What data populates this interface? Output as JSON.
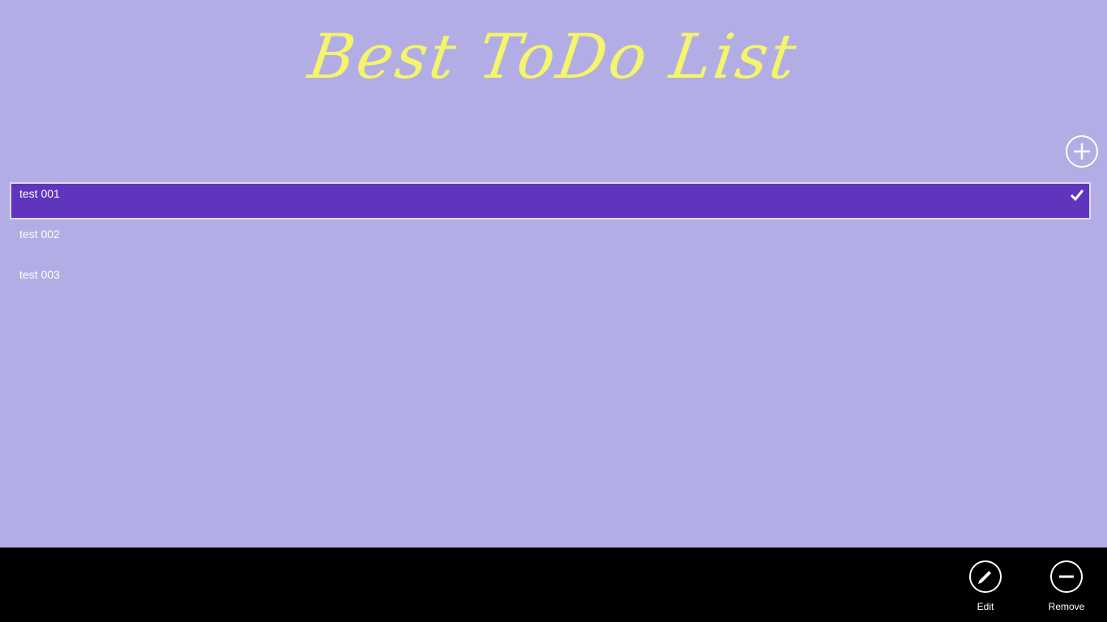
{
  "app": {
    "title": "Best ToDo List"
  },
  "colors": {
    "background": "#b3ade6",
    "title": "#f4f56a",
    "selected_item": "#5f35bd",
    "app_bar": "#000000"
  },
  "toolbar": {
    "add_icon": "plus-circle-icon"
  },
  "todos": [
    {
      "label": "test 001",
      "selected": true,
      "icon": "checkmark-icon"
    },
    {
      "label": "test 002",
      "selected": false
    },
    {
      "label": "test 003",
      "selected": false
    }
  ],
  "app_bar": {
    "edit_label": "Edit",
    "edit_icon": "pencil-icon",
    "remove_label": "Remove",
    "remove_icon": "minus-icon"
  }
}
